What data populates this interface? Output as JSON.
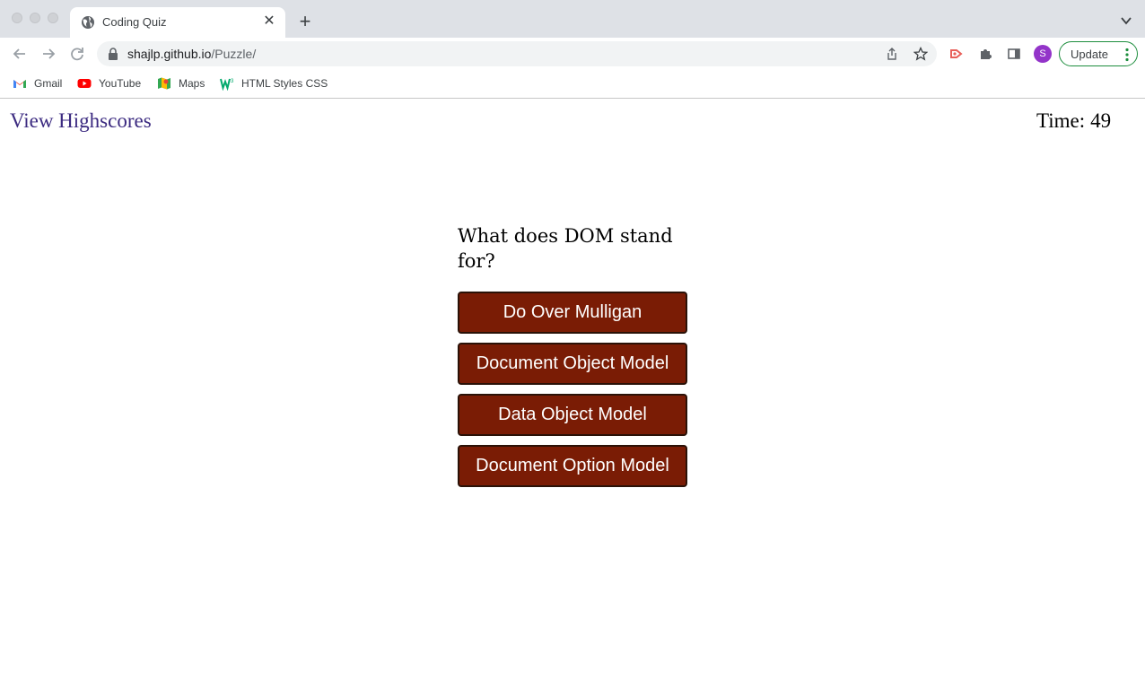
{
  "browser": {
    "tab": {
      "title": "Coding Quiz"
    },
    "url": {
      "host": "shajlp.github.io",
      "path": "/Puzzle/"
    },
    "avatar_letter": "S",
    "update_label": "Update",
    "bookmarks": [
      {
        "label": "Gmail",
        "icon": "gmail-icon"
      },
      {
        "label": "YouTube",
        "icon": "youtube-icon"
      },
      {
        "label": "Maps",
        "icon": "maps-icon"
      },
      {
        "label": "HTML Styles CSS",
        "icon": "w3schools-icon"
      }
    ],
    "colors": {
      "tabstrip": "#dee1e6",
      "update_border": "#1e8e3e",
      "avatar": "#9334c9"
    }
  },
  "page": {
    "highscores_link": "View Highscores",
    "timer": {
      "label": "Time:",
      "value": "49"
    },
    "question": "What does DOM stand for?",
    "answers": [
      "Do Over Mulligan",
      "Document Object Model",
      "Data Object Model",
      "Document Option Model"
    ],
    "colors": {
      "answer_button": "#7a1c05",
      "link": "#3b2a80"
    }
  }
}
